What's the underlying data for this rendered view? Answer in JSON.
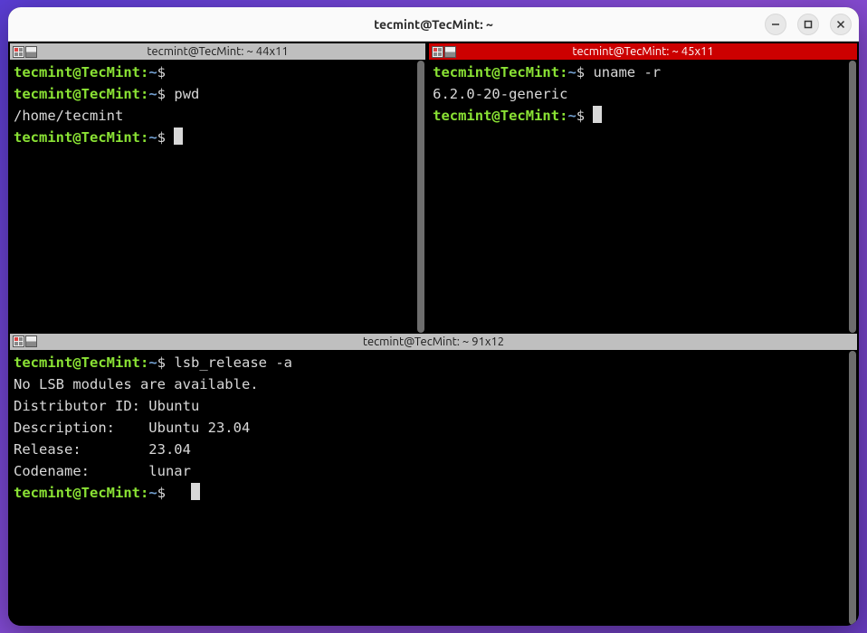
{
  "window": {
    "title": "tecmint@TecMint: ~"
  },
  "panes": {
    "topLeft": {
      "title": "tecmint@TecMint: ~ 44x11",
      "user": "tecmint@TecMint",
      "path": "~",
      "sep": ":",
      "dollar": "$",
      "lines": [
        {
          "cmd": ""
        },
        {
          "cmd": "pwd"
        },
        {
          "out": "/home/tecmint"
        },
        {
          "cmd": "",
          "cursor": true
        }
      ]
    },
    "topRight": {
      "title": "tecmint@TecMint: ~ 45x11",
      "user": "tecmint@TecMint",
      "path": "~",
      "sep": ":",
      "dollar": "$",
      "lines": [
        {
          "cmd": "uname -r"
        },
        {
          "out": "6.2.0-20-generic"
        },
        {
          "cmd": "",
          "cursor": true
        }
      ]
    },
    "bottom": {
      "title": "tecmint@TecMint: ~ 91x12",
      "user": "tecmint@TecMint",
      "path": "~",
      "sep": ":",
      "dollar": "$",
      "lines": [
        {
          "cmd": "lsb_release -a"
        },
        {
          "out": "No LSB modules are available."
        },
        {
          "out": "Distributor ID: Ubuntu"
        },
        {
          "out": "Description:    Ubuntu 23.04"
        },
        {
          "out": "Release:        23.04"
        },
        {
          "out": "Codename:       lunar"
        },
        {
          "cmd": "  ",
          "cursor": true
        }
      ]
    }
  }
}
